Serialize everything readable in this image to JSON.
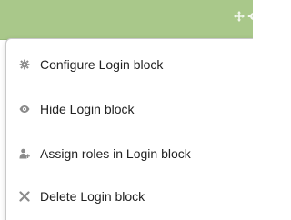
{
  "block": {
    "header_color": "#a9c88a",
    "controls": [
      {
        "icon": "move-icon"
      },
      {
        "icon": "gear-icon"
      }
    ]
  },
  "menu": {
    "items": [
      {
        "label": "Configure Login block",
        "icon": "gear-icon"
      },
      {
        "label": "Hide Login block",
        "icon": "eye-icon"
      },
      {
        "label": "Assign roles in Login block",
        "icon": "assign-role-icon"
      },
      {
        "label": "Delete Login block",
        "icon": "delete-icon"
      }
    ]
  }
}
